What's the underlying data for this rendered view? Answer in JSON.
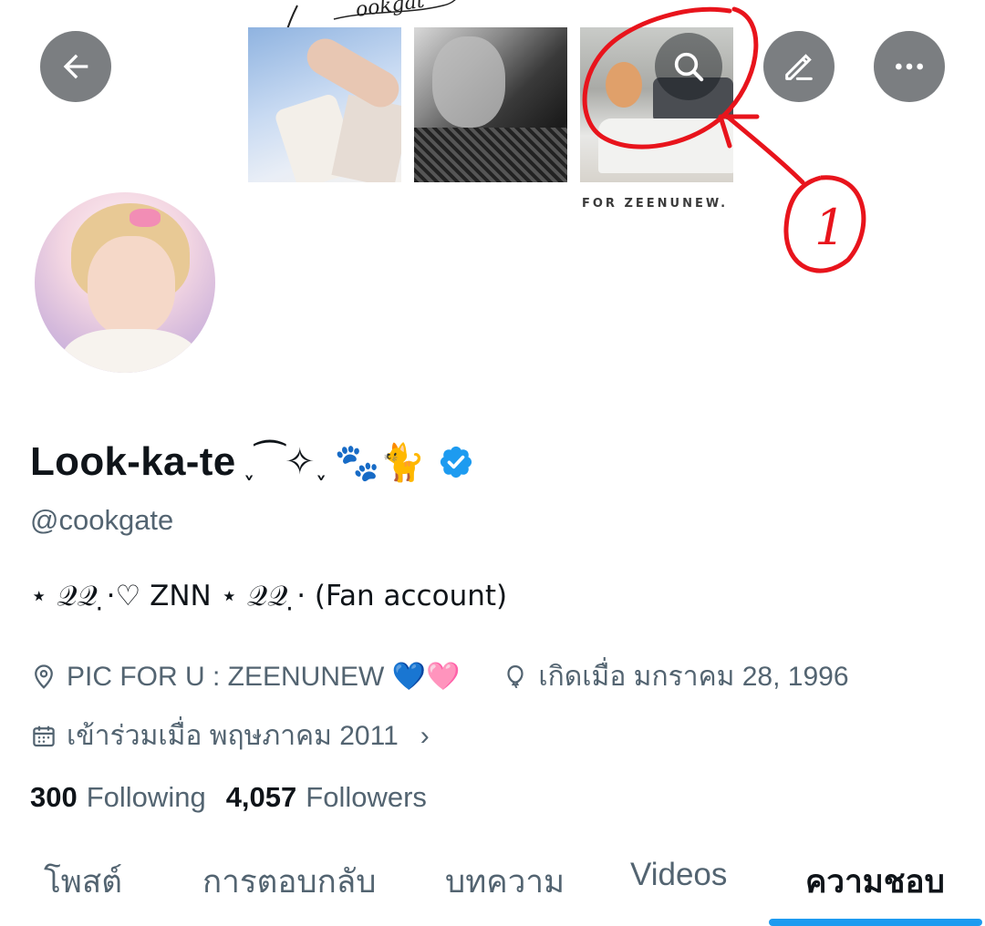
{
  "header": {
    "banner_caption": "FOR ZEENUNEW.",
    "banner_script": "Cookgate",
    "annotation_number": "1"
  },
  "buttons": {
    "back_icon": "arrow-left-icon",
    "search_icon": "search-icon",
    "edit_icon": "pencil-icon",
    "more_icon": "more-horizontal-icon"
  },
  "profile": {
    "display_name": "Look-ka-te",
    "name_decoration": "˯⁀✧˯",
    "name_emoji": "🐾🐈",
    "handle": "@cookgate",
    "bio": "⋆ 𝒬𝒬 ̣⋅♡ ZNN ⋆ 𝒬𝒬 ̣⋅ (Fan account)",
    "location": "PIC FOR U : ZEENUNEW 💙🩷",
    "birthday": "เกิดเมื่อ มกราคม 28, 1996",
    "joined": "เข้าร่วมเมื่อ พฤษภาคม 2011",
    "verified_color": "#1d9bf0"
  },
  "stats": {
    "following_count": "300",
    "following_label": "Following",
    "followers_count": "4,057",
    "followers_label": "Followers"
  },
  "tabs": [
    {
      "label": "โพสต์"
    },
    {
      "label": "การตอบกลับ"
    },
    {
      "label": "บทความ"
    },
    {
      "label": "Videos"
    },
    {
      "label": "ความชอบ",
      "active": true
    }
  ],
  "colors": {
    "accent": "#1d9bf0",
    "annotation": "#e8141c",
    "secondary_text": "#536471"
  }
}
